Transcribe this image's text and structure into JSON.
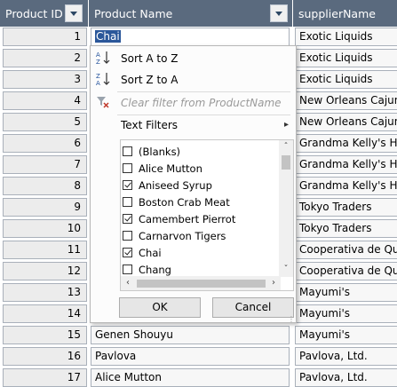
{
  "columns": {
    "id": "Product ID",
    "name": "Product Name",
    "supplier": "supplierName"
  },
  "rows": [
    {
      "id": "1",
      "name": "Chai",
      "supplier": "Exotic Liquids"
    },
    {
      "id": "2",
      "name": "",
      "supplier": "Exotic Liquids"
    },
    {
      "id": "3",
      "name": "",
      "supplier": "Exotic Liquids"
    },
    {
      "id": "4",
      "name": "",
      "supplier": "New Orleans Cajun"
    },
    {
      "id": "5",
      "name": "",
      "supplier": "New Orleans Cajun"
    },
    {
      "id": "6",
      "name": "",
      "supplier": "Grandma Kelly's H"
    },
    {
      "id": "7",
      "name": "",
      "supplier": "Grandma Kelly's H"
    },
    {
      "id": "8",
      "name": "",
      "supplier": "Grandma Kelly's H"
    },
    {
      "id": "9",
      "name": "",
      "supplier": "Tokyo Traders"
    },
    {
      "id": "10",
      "name": "",
      "supplier": "Tokyo Traders"
    },
    {
      "id": "11",
      "name": "",
      "supplier": "Cooperativa de Qu"
    },
    {
      "id": "12",
      "name": "",
      "supplier": "Cooperativa de Qu"
    },
    {
      "id": "13",
      "name": "",
      "supplier": "Mayumi's"
    },
    {
      "id": "14",
      "name": "",
      "supplier": "Mayumi's"
    },
    {
      "id": "15",
      "name": "Genen Shouyu",
      "supplier": "Mayumi's"
    },
    {
      "id": "16",
      "name": "Pavlova",
      "supplier": "Pavlova, Ltd."
    },
    {
      "id": "17",
      "name": "Alice Mutton",
      "supplier": "Pavlova, Ltd."
    }
  ],
  "menu": {
    "sort_az": "Sort A to Z",
    "sort_za": "Sort Z to A",
    "clear_filter": "Clear filter from ProductName",
    "text_filters": "Text Filters",
    "items": [
      {
        "label": "(Blanks)",
        "checked": false
      },
      {
        "label": "Alice Mutton",
        "checked": false
      },
      {
        "label": "Aniseed Syrup",
        "checked": true
      },
      {
        "label": "Boston Crab Meat",
        "checked": false
      },
      {
        "label": "Camembert Pierrot",
        "checked": true
      },
      {
        "label": "Carnarvon Tigers",
        "checked": false
      },
      {
        "label": "Chai",
        "checked": true
      },
      {
        "label": "Chang",
        "checked": false
      }
    ],
    "ok": "OK",
    "cancel": "Cancel"
  },
  "colors": {
    "header_bg": "#5a6a7e",
    "selection": "#2b579a"
  }
}
